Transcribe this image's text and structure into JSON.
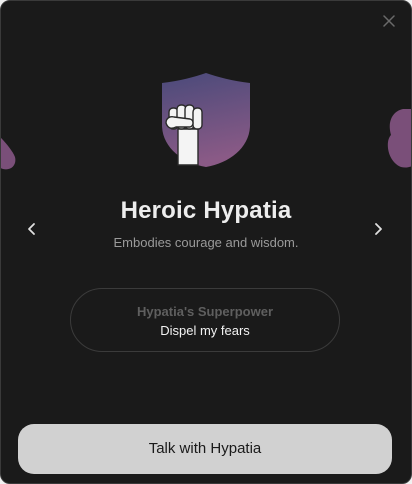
{
  "hero": {
    "title": "Heroic Hypatia",
    "subtitle": "Embodies courage and wisdom.",
    "emblem_icon": "shield-fist-icon"
  },
  "superpower": {
    "label": "Hypatia's Superpower",
    "value": "Dispel my fears"
  },
  "cta": {
    "label": "Talk with Hypatia"
  },
  "colors": {
    "background": "#1a1a1a",
    "shield_top": "#4a4a7a",
    "shield_bottom": "#8a5a86",
    "cta_bg": "#d1d1d1"
  }
}
